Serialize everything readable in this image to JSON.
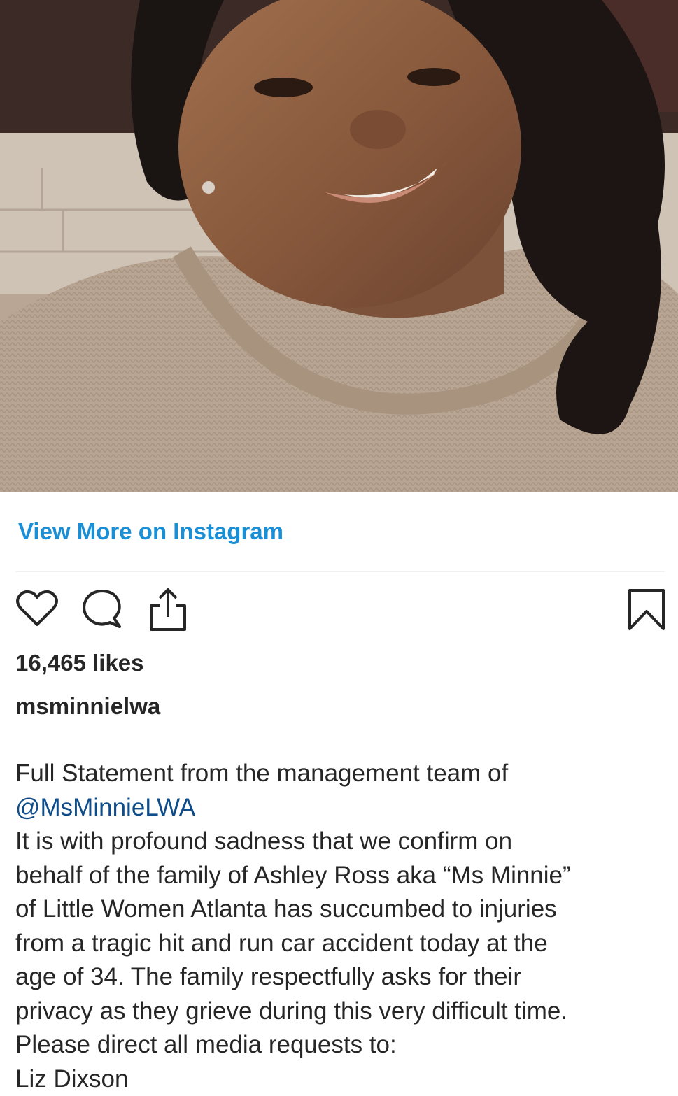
{
  "post": {
    "photo_icon": "portrait-photo",
    "view_more_label": "View More on Instagram",
    "likes_label": "16,465 likes",
    "username": "msminnielwa",
    "caption_lines": [
      "Full Statement from the management team of",
      "@MsMinnieLWA",
      "It is with profound sadness that we confirm on",
      "behalf of the family of Ashley Ross aka “Ms Minnie”",
      "of Little Women Atlanta has succumbed to injuries",
      "from a tragic hit and run car accident today at the",
      "age of 34. The family respectfully asks for their",
      "privacy as they grieve during this very difficult time.",
      "Please direct all media requests to:",
      "Liz Dixson"
    ]
  },
  "icons": {
    "like": "heart-icon",
    "comment": "comment-bubble-icon",
    "share": "share-icon",
    "save": "bookmark-icon"
  },
  "colors": {
    "link_blue": "#1a8fd6",
    "mention_blue": "#0f4d8a",
    "text": "#262626",
    "divider": "#efefef"
  }
}
